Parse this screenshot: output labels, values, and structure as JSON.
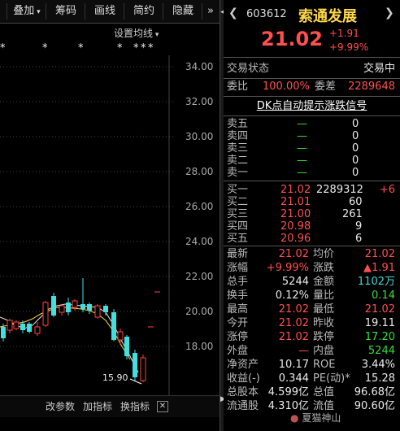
{
  "toolbar": {
    "items": [
      "叠加",
      "筹码",
      "画线",
      "简约",
      "隐藏"
    ],
    "more": "»",
    "setting": "设置均线"
  },
  "chart": {
    "price_ticks": [
      "34.00",
      "32.00",
      "30.00",
      "28.00",
      "26.00",
      "24.00",
      "22.00",
      "20.00",
      "18.00"
    ],
    "low_label": "15.90",
    "markers": [
      "*",
      "*",
      "*",
      "*",
      "*",
      "*",
      "*"
    ],
    "bottom_buttons": [
      "改参数",
      "加指标",
      "换指标"
    ]
  },
  "quote": {
    "code": "603612",
    "name": "索通发展",
    "price": "21.02",
    "change": "+1.91",
    "change_pct": "+9.99%",
    "status_label": "交易状态",
    "status_value": "交易中",
    "wb_label": "委比",
    "wb_value": "100.00%",
    "wc_label": "委差",
    "wc_value": "2289648",
    "dk_link": "DK点自动提示涨跌信号"
  },
  "orderbook": {
    "sell": [
      {
        "label": "卖五",
        "price": "—",
        "vol": "0"
      },
      {
        "label": "卖四",
        "price": "—",
        "vol": "0"
      },
      {
        "label": "卖三",
        "price": "—",
        "vol": "0"
      },
      {
        "label": "卖二",
        "price": "—",
        "vol": "0"
      },
      {
        "label": "卖一",
        "price": "—",
        "vol": "0"
      }
    ],
    "buy": [
      {
        "label": "买一",
        "price": "21.02",
        "vol": "2289312",
        "delta": "+6"
      },
      {
        "label": "买二",
        "price": "21.01",
        "vol": "60",
        "delta": ""
      },
      {
        "label": "买三",
        "price": "21.00",
        "vol": "261",
        "delta": ""
      },
      {
        "label": "买四",
        "price": "20.98",
        "vol": "9",
        "delta": ""
      },
      {
        "label": "买五",
        "price": "20.96",
        "vol": "6",
        "delta": ""
      }
    ]
  },
  "stats": [
    {
      "l1": "最新",
      "v1": "21.02",
      "c1": "red",
      "l2": "均价",
      "v2": "21.02",
      "c2": "red"
    },
    {
      "l1": "涨幅",
      "v1": "+9.99%",
      "c1": "red",
      "l2": "涨跌",
      "v2": "▲1.91",
      "c2": "red"
    },
    {
      "l1": "总手",
      "v1": "5244",
      "c1": "white",
      "l2": "金额",
      "v2": "1102万",
      "c2": "cyan"
    },
    {
      "l1": "换手",
      "v1": "0.12%",
      "c1": "white",
      "l2": "量比",
      "v2": "0.14",
      "c2": "green"
    },
    {
      "l1": "最高",
      "v1": "21.02",
      "c1": "red",
      "l2": "最低",
      "v2": "21.02",
      "c2": "red"
    },
    {
      "l1": "今开",
      "v1": "21.02",
      "c1": "red",
      "l2": "昨收",
      "v2": "19.11",
      "c2": "white"
    },
    {
      "l1": "涨停",
      "v1": "21.02",
      "c1": "red",
      "l2": "跌停",
      "v2": "17.20",
      "c2": "green"
    },
    {
      "l1": "外盘",
      "v1": "—",
      "c1": "red",
      "l2": "内盘",
      "v2": "5244",
      "c2": "green"
    },
    {
      "l1": "净资产",
      "v1": "10.17",
      "c1": "white",
      "l2": "ROE",
      "v2": "3.44%",
      "c2": "white"
    },
    {
      "l1": "收益(-)",
      "v1": "0.344",
      "c1": "white",
      "l2": "PE(动)*",
      "v2": "15.28",
      "c2": "white"
    },
    {
      "l1": "总股本",
      "v1": "4.599亿",
      "c1": "white",
      "l2": "总值",
      "v2": "96.68亿",
      "c2": "white"
    },
    {
      "l1": "流通股",
      "v1": "4.310亿",
      "c1": "white",
      "l2": "流值",
      "v2": "90.60亿",
      "c2": "white"
    }
  ],
  "watermark": "夏猫神山"
}
